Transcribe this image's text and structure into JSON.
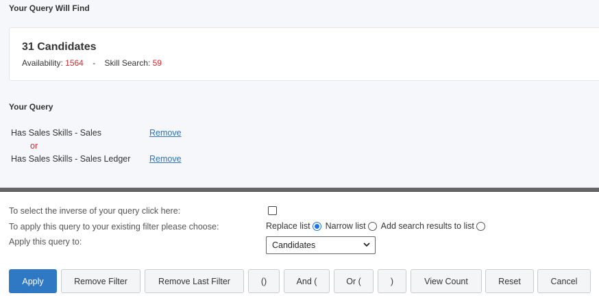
{
  "summary": {
    "heading": "Your Query Will Find",
    "count": "31 Candidates",
    "availability_label": "Availability:",
    "availability_value": "1564",
    "separator": "-",
    "skill_search_label": "Skill Search:",
    "skill_search_value": "59"
  },
  "query": {
    "heading": "Your Query",
    "items": [
      {
        "label": "Has Sales Skills - Sales",
        "remove": "Remove"
      },
      {
        "label": "Has Sales Skills - Sales Ledger",
        "remove": "Remove"
      }
    ],
    "joiner": "or"
  },
  "options": {
    "inverse_label": "To select the inverse of your query click here:",
    "inverse_checked": false,
    "apply_mode_label": "To apply this query to your existing filter please choose:",
    "modes": [
      {
        "label": "Replace list",
        "checked": true
      },
      {
        "label": "Narrow list",
        "checked": false
      },
      {
        "label": "Add search results to list",
        "checked": false
      }
    ],
    "apply_to_label": "Apply this query to:",
    "apply_to_value": "Candidates"
  },
  "buttons": {
    "apply": "Apply",
    "remove_filter": "Remove Filter",
    "remove_last_filter": "Remove Last Filter",
    "parens": "()",
    "and": "And (",
    "or": "Or (",
    "close_paren": ")",
    "view_count": "View Count",
    "reset": "Reset",
    "cancel": "Cancel"
  },
  "colors": {
    "accent": "#2f79c4",
    "highlight_red": "#d9262a"
  }
}
